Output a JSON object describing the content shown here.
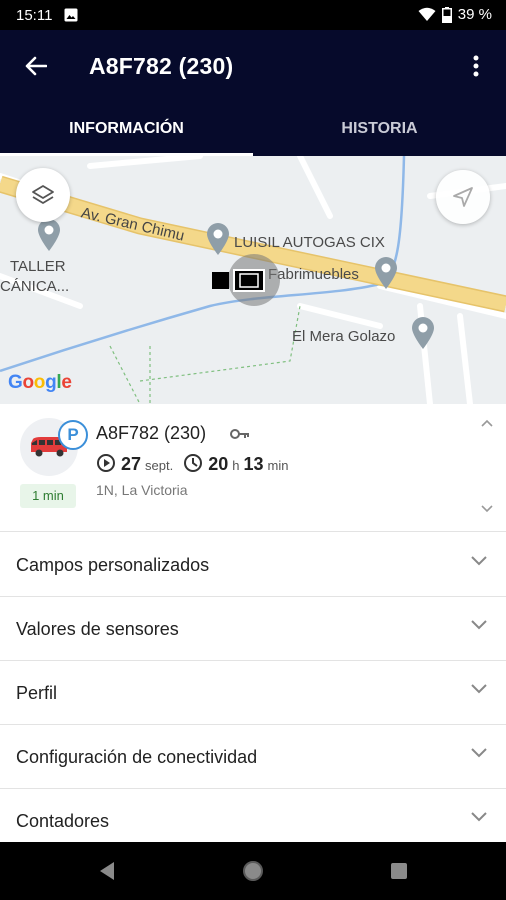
{
  "status": {
    "time": "15:11",
    "battery": "39 %"
  },
  "header": {
    "title": "A8F782 (230)"
  },
  "tabs": [
    {
      "label": "INFORMACIÓN",
      "active": true
    },
    {
      "label": "HISTORIA",
      "active": false
    }
  ],
  "map": {
    "road_label": "Av. Gran Chimu",
    "places": [
      "TALLER",
      "CÁNICA...",
      "LUISIL AUTOGAS CIX",
      "Fabrimuebles",
      "El Mera Golazo"
    ],
    "attribution": "Google"
  },
  "vehicle": {
    "name": "A8F782 (230)",
    "parking_badge": "P",
    "date_day": "27",
    "date_month": "sept.",
    "duration_hours": "20",
    "duration_hours_unit": "h",
    "duration_minutes": "13",
    "duration_minutes_unit": "min",
    "address": "1N, La Victoria",
    "time_ago": "1 min"
  },
  "sections": [
    {
      "label": "Campos personalizados"
    },
    {
      "label": "Valores de sensores"
    },
    {
      "label": "Perfil"
    },
    {
      "label": "Configuración de conectividad"
    },
    {
      "label": "Contadores"
    }
  ],
  "colors": {
    "app_bar": "#060a2b",
    "accent": "#3b8fd9",
    "road": "#f4d88a",
    "water": "#8fb8e8"
  }
}
